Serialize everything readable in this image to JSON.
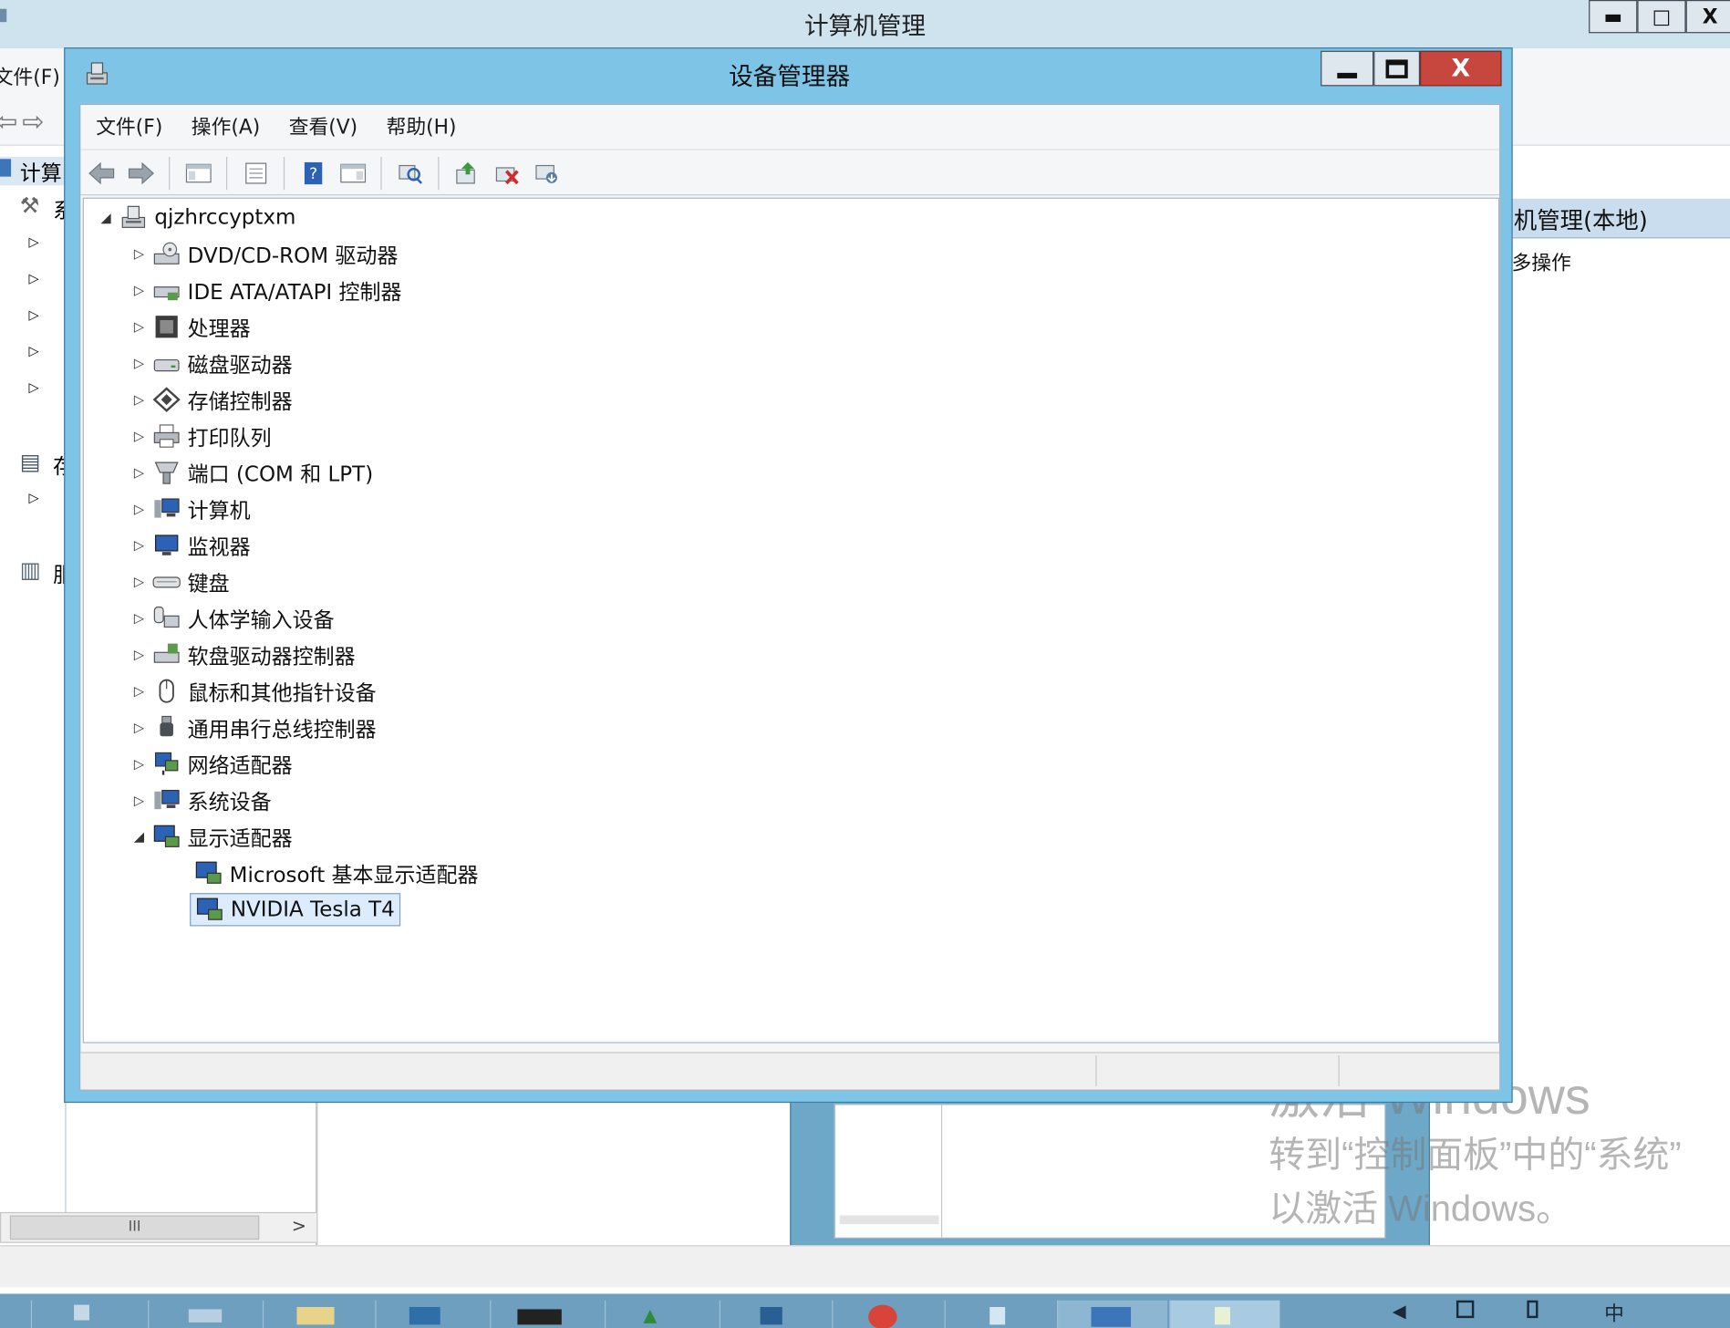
{
  "background_window": {
    "title": "计算机管理",
    "menu_file": "文件(F)",
    "tree_label": "计算",
    "left_items": [
      "系",
      "存",
      "服"
    ],
    "right_header": "机管理(本地)",
    "right_action": "多操作",
    "scroll_thumb": "III",
    "scroll_right": ">",
    "min_label": "▬",
    "max_label": "□",
    "close_label": "X"
  },
  "device_manager": {
    "title": "设备管理器",
    "close_label": "X",
    "menu": [
      "文件(F)",
      "操作(A)",
      "查看(V)",
      "帮助(H)"
    ],
    "root": "qjzhrccyptxm",
    "categories": [
      {
        "label": "DVD/CD-ROM 驱动器",
        "icon": "dvd-drive-icon",
        "expanded": false
      },
      {
        "label": "IDE ATA/ATAPI 控制器",
        "icon": "ide-controller-icon",
        "expanded": false
      },
      {
        "label": "处理器",
        "icon": "processor-icon",
        "expanded": false
      },
      {
        "label": "磁盘驱动器",
        "icon": "disk-drive-icon",
        "expanded": false
      },
      {
        "label": "存储控制器",
        "icon": "storage-controller-icon",
        "expanded": false
      },
      {
        "label": "打印队列",
        "icon": "printer-icon",
        "expanded": false
      },
      {
        "label": "端口 (COM 和 LPT)",
        "icon": "port-icon",
        "expanded": false
      },
      {
        "label": "计算机",
        "icon": "computer-icon",
        "expanded": false
      },
      {
        "label": "监视器",
        "icon": "monitor-icon",
        "expanded": false
      },
      {
        "label": "键盘",
        "icon": "keyboard-icon",
        "expanded": false
      },
      {
        "label": "人体学输入设备",
        "icon": "hid-icon",
        "expanded": false
      },
      {
        "label": "软盘驱动器控制器",
        "icon": "floppy-controller-icon",
        "expanded": false
      },
      {
        "label": "鼠标和其他指针设备",
        "icon": "mouse-icon",
        "expanded": false
      },
      {
        "label": "通用串行总线控制器",
        "icon": "usb-icon",
        "expanded": false
      },
      {
        "label": "网络适配器",
        "icon": "network-adapter-icon",
        "expanded": false
      },
      {
        "label": "系统设备",
        "icon": "system-device-icon",
        "expanded": false
      },
      {
        "label": "显示适配器",
        "icon": "display-adapter-icon",
        "expanded": true
      }
    ],
    "display_adapters": [
      {
        "label": "Microsoft 基本显示适配器",
        "selected": false
      },
      {
        "label": "NVIDIA Tesla T4",
        "selected": true
      }
    ]
  },
  "watermark": {
    "line1": "激活 Windows",
    "line2": "转到“控制面板”中的“系统”",
    "line3": "以激活 Windows。"
  },
  "colors": {
    "titlebar": "#7ec4e6",
    "close": "#c7463d",
    "selection": "#dcecfc",
    "taskbar": "#6e9fbf"
  }
}
